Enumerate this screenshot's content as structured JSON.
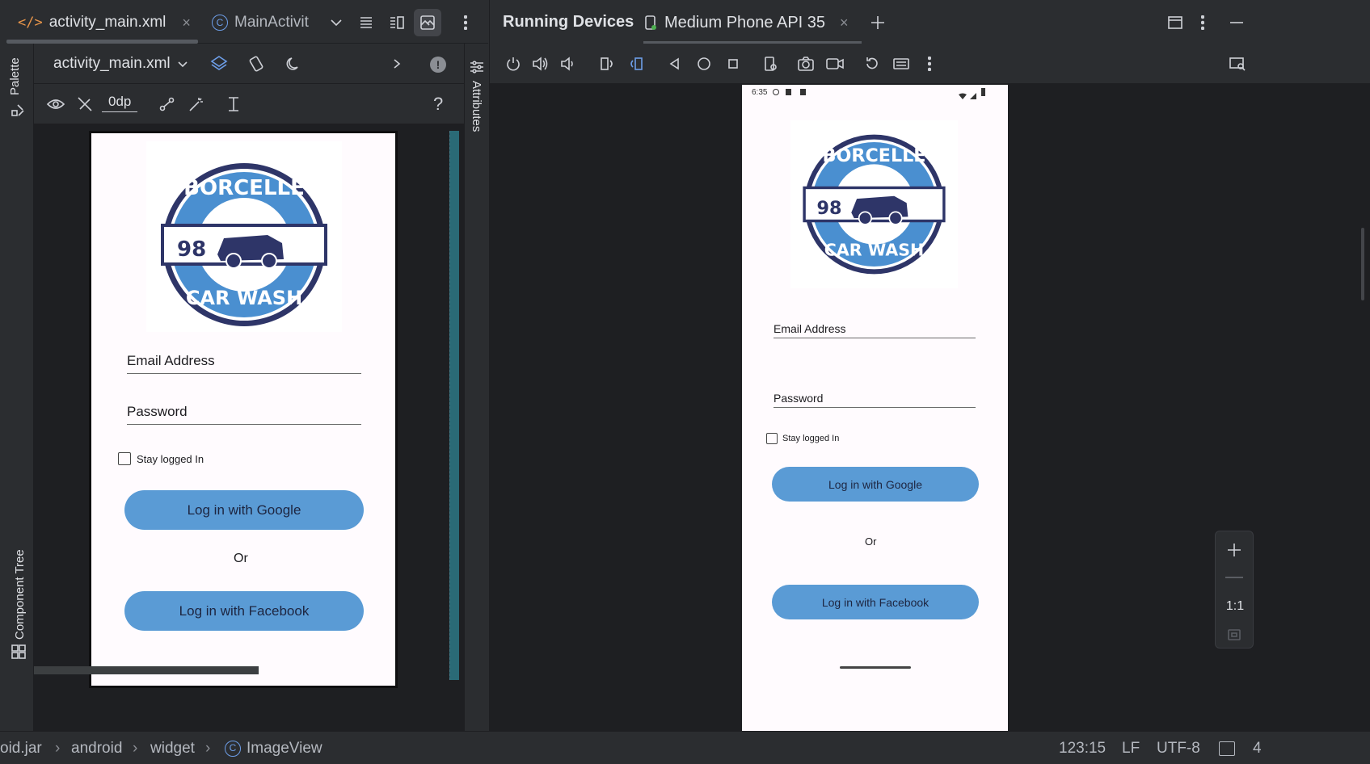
{
  "editor_tabs": {
    "tab1": "activity_main.xml",
    "tab2": "MainActivit"
  },
  "left_sidebar": {
    "palette": "Palette",
    "component_tree": "Component Tree"
  },
  "design_toolbar": {
    "file_dropdown": "activity_main.xml",
    "margin_value": "0dp",
    "help": "?"
  },
  "attributes_label": "Attributes",
  "running_devices": {
    "title": "Running Devices",
    "device_tab": "Medium Phone API 35"
  },
  "app_screen": {
    "logo": {
      "brand": "BORCELLE",
      "subtitle": "CAR WASH",
      "number": "98"
    },
    "email_hint": "Email Address",
    "password_hint": "Password",
    "stay_logged_in": "Stay logged In",
    "google_button": "Log in with Google",
    "or_text": "Or",
    "facebook_button": "Log in with Facebook"
  },
  "emulator_status": {
    "time": "6:35"
  },
  "zoom_panel": {
    "ratio": "1:1"
  },
  "status_bar": {
    "breadcrumb": [
      "oid.jar",
      "android",
      "widget",
      "ImageView"
    ],
    "position": "123:15",
    "line_ending": "LF",
    "encoding": "UTF-8",
    "indent": "4"
  },
  "colors": {
    "ide_background": "#2b2d30",
    "canvas_background": "#1e1f22",
    "app_background": "#fffbfe",
    "button_fill": "#5a9bd5",
    "logo_navy": "#2e3568",
    "logo_blue": "#4a8fd0"
  }
}
